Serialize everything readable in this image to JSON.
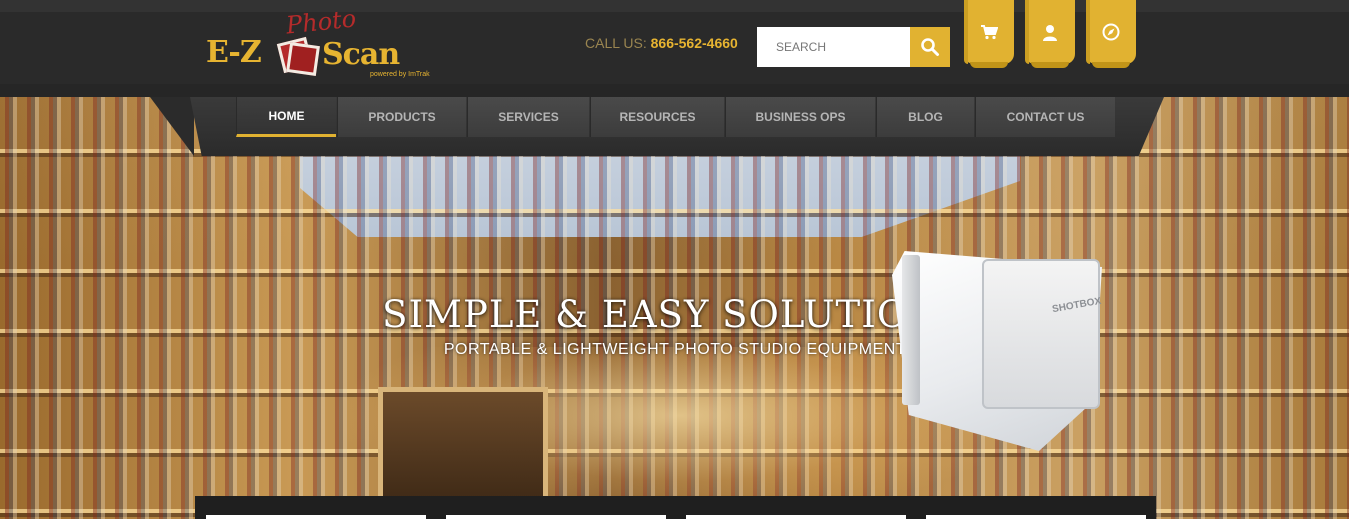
{
  "brand": {
    "name": "E-Z Photo Scan",
    "logo_photo": "Photo",
    "logo_ez": "E-Z",
    "logo_scan": "Scan",
    "logo_powered": "powered by ImTrak"
  },
  "header": {
    "call_label": "CALL US:",
    "phone": "866-562-4660",
    "search_placeholder": "SEARCH",
    "icons": [
      "cart-icon",
      "user-icon",
      "compass-icon"
    ]
  },
  "nav": {
    "items": [
      {
        "label": "HOME",
        "active": true
      },
      {
        "label": "PRODUCTS",
        "active": false
      },
      {
        "label": "SERVICES",
        "active": false
      },
      {
        "label": "RESOURCES",
        "active": false
      },
      {
        "label": "BUSINESS OPS",
        "active": false
      },
      {
        "label": "BLOG",
        "active": false
      },
      {
        "label": "CONTACT US",
        "active": false
      }
    ]
  },
  "hero": {
    "title": "SIMPLE & EASY SOLUTIONS",
    "subtitle": "PORTABLE & LIGHTWEIGHT PHOTO STUDIO EQUIPMENT",
    "product_brand": "SHOTBOX"
  },
  "colors": {
    "accent": "#e1b231",
    "header_bg": "#2a2a2a",
    "nav_text": "#b5b5b5"
  }
}
